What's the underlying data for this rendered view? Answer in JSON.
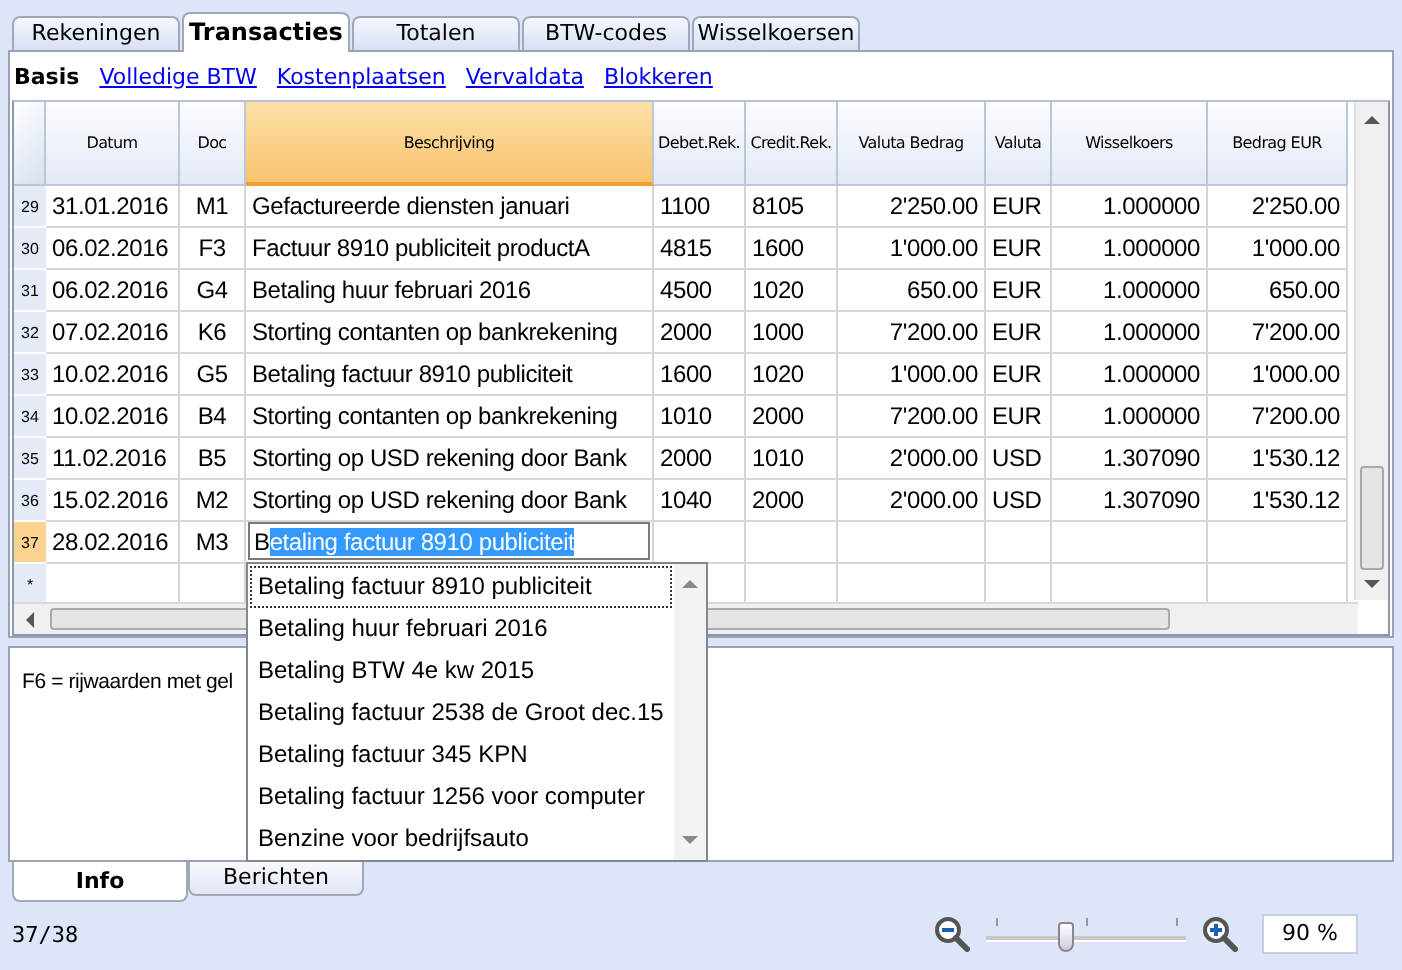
{
  "tabs": [
    {
      "label": "Rekeningen",
      "selected": false
    },
    {
      "label": "Transacties",
      "selected": true
    },
    {
      "label": "Totalen",
      "selected": false
    },
    {
      "label": "BTW-codes",
      "selected": false
    },
    {
      "label": "Wisselkoersen",
      "selected": false
    }
  ],
  "views": [
    {
      "label": "Basis",
      "selected": true
    },
    {
      "label": "Volledige BTW",
      "selected": false
    },
    {
      "label": "Kostenplaatsen",
      "selected": false
    },
    {
      "label": "Vervaldata",
      "selected": false
    },
    {
      "label": "Blokkeren",
      "selected": false
    }
  ],
  "table": {
    "columns": [
      {
        "label": "Datum",
        "selected": false
      },
      {
        "label": "Doc",
        "selected": false
      },
      {
        "label": "Beschrijving",
        "selected": true
      },
      {
        "label": "Debet.Rek.",
        "selected": false
      },
      {
        "label": "Credit.Rek.",
        "selected": false
      },
      {
        "label": "Valuta Bedrag",
        "selected": false
      },
      {
        "label": "Valuta",
        "selected": false
      },
      {
        "label": "Wisselkoers",
        "selected": false
      },
      {
        "label": "Bedrag EUR",
        "selected": false
      }
    ],
    "rows": [
      {
        "number": "29",
        "selected": false,
        "cells": [
          "31.01.2016",
          "M1",
          "Gefactureerde diensten januari",
          "1100",
          "8105",
          "2'250.00",
          "EUR",
          "1.000000",
          "2'250.00"
        ]
      },
      {
        "number": "30",
        "selected": false,
        "cells": [
          "06.02.2016",
          "F3",
          "Factuur 8910 publiciteit productA",
          "4815",
          "1600",
          "1'000.00",
          "EUR",
          "1.000000",
          "1'000.00"
        ]
      },
      {
        "number": "31",
        "selected": false,
        "cells": [
          "06.02.2016",
          "G4",
          "Betaling huur februari 2016",
          "4500",
          "1020",
          "650.00",
          "EUR",
          "1.000000",
          "650.00"
        ]
      },
      {
        "number": "32",
        "selected": false,
        "cells": [
          "07.02.2016",
          "K6",
          "Storting contanten op bankrekening",
          "2000",
          "1000",
          "7'200.00",
          "EUR",
          "1.000000",
          "7'200.00"
        ]
      },
      {
        "number": "33",
        "selected": false,
        "cells": [
          "10.02.2016",
          "G5",
          "Betaling factuur 8910 publiciteit",
          "1600",
          "1020",
          "1'000.00",
          "EUR",
          "1.000000",
          "1'000.00"
        ]
      },
      {
        "number": "34",
        "selected": false,
        "cells": [
          "10.02.2016",
          "B4",
          "Storting contanten op bankrekening",
          "1010",
          "2000",
          "7'200.00",
          "EUR",
          "1.000000",
          "7'200.00"
        ]
      },
      {
        "number": "35",
        "selected": false,
        "cells": [
          "11.02.2016",
          "B5",
          "Storting op USD rekening door Bank",
          "2000",
          "1010",
          "2'000.00",
          "USD",
          "1.307090",
          "1'530.12"
        ]
      },
      {
        "number": "36",
        "selected": false,
        "cells": [
          "15.02.2016",
          "M2",
          "Storting op USD rekening door Bank",
          "1040",
          "2000",
          "2'000.00",
          "USD",
          "1.307090",
          "1'530.12"
        ]
      },
      {
        "number": "37",
        "selected": true,
        "cells": [
          "28.02.2016",
          "M3",
          null,
          "",
          "",
          "",
          "",
          "",
          ""
        ],
        "editor": {
          "typed": "B",
          "suggested": "etaling factuur 8910 publiciteit"
        }
      },
      {
        "number": "*",
        "selected": false,
        "cells": [
          "",
          "",
          "",
          "",
          "",
          "",
          "",
          "",
          ""
        ]
      }
    ]
  },
  "autocomplete": [
    {
      "label": "Betaling factuur 8910 publiciteit",
      "selected": true
    },
    {
      "label": "Betaling huur februari 2016",
      "selected": false
    },
    {
      "label": "Betaling BTW 4e kw 2015",
      "selected": false
    },
    {
      "label": "Betaling factuur 2538 de Groot dec.15",
      "selected": false
    },
    {
      "label": "Betaling factuur 345 KPN",
      "selected": false
    },
    {
      "label": "Betaling factuur 1256 voor computer",
      "selected": false
    },
    {
      "label": "Benzine voor bedrijfsauto",
      "selected": false
    }
  ],
  "info": {
    "text": "F6 = rijwaarden met gel"
  },
  "bottom_tabs": [
    {
      "label": "Info",
      "selected": true
    },
    {
      "label": "Berichten",
      "selected": false
    }
  ],
  "status_bar": {
    "position": "37/38",
    "zoom": {
      "level": 0.4,
      "value": "90 %"
    }
  }
}
